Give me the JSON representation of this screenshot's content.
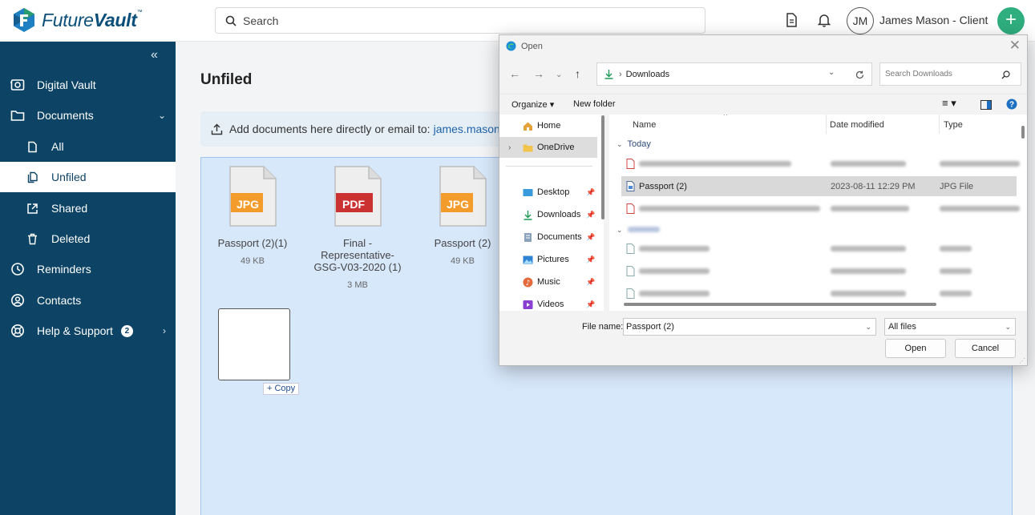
{
  "app": {
    "brand_part1": "Future",
    "brand_part2": "Vault",
    "search_placeholder": "Search",
    "user_initials": "JM",
    "user_name": "James Mason - Client",
    "add_button": "+",
    "accent_color": "#2fae7f",
    "nav_color": "#0d4466"
  },
  "sidebar": {
    "collapse": "«",
    "items": [
      {
        "label": "Digital Vault",
        "icon": "vault-icon"
      },
      {
        "label": "Documents",
        "icon": "folder-icon",
        "chevron": "⌄"
      },
      {
        "label": "All",
        "icon": "document-icon"
      },
      {
        "label": "Unfiled",
        "icon": "copy-document-icon"
      },
      {
        "label": "Shared",
        "icon": "share-icon"
      },
      {
        "label": "Deleted",
        "icon": "trash-icon"
      },
      {
        "label": "Reminders",
        "icon": "clock-icon"
      },
      {
        "label": "Contacts",
        "icon": "contacts-icon"
      },
      {
        "label": "Help & Support",
        "icon": "support-icon",
        "badge": "2",
        "chevron": "›"
      }
    ]
  },
  "main": {
    "title": "Unfiled",
    "add_text": "Add documents here directly or email to:",
    "add_email": "james.mason.",
    "files": [
      {
        "type": "JPG",
        "name": "Passport (2)(1)",
        "size": "49 KB"
      },
      {
        "type": "PDF",
        "name": "Final - Representative-GSG-V03-2020 (1)",
        "size": "3 MB"
      },
      {
        "type": "JPG",
        "name": "Passport (2)",
        "size": "49 KB"
      }
    ],
    "copy_label": "+ Copy"
  },
  "dialog": {
    "title": "Open",
    "close": "✕",
    "path": "Downloads",
    "search_placeholder": "Search Downloads",
    "organize": "Organize ▾",
    "new_folder": "New folder",
    "nav": [
      {
        "label": "Home",
        "icon": "home-icon"
      },
      {
        "label": "OneDrive",
        "icon": "folder-icon"
      },
      {
        "label": "Desktop",
        "icon": "desktop-icon"
      },
      {
        "label": "Downloads",
        "icon": "download-icon"
      },
      {
        "label": "Documents",
        "icon": "documents-icon"
      },
      {
        "label": "Pictures",
        "icon": "pictures-icon"
      },
      {
        "label": "Music",
        "icon": "music-icon"
      },
      {
        "label": "Videos",
        "icon": "videos-icon"
      }
    ],
    "columns": [
      "Name",
      "Date modified",
      "Type"
    ],
    "group_today": "Today",
    "selected_file": {
      "name": "Passport (2)",
      "date": "2023-08-11 12:29 PM",
      "type": "JPG File"
    },
    "file_name_label": "File name:",
    "file_name_value": "Passport (2)",
    "file_type": "All files",
    "open_btn": "Open",
    "cancel_btn": "Cancel"
  }
}
